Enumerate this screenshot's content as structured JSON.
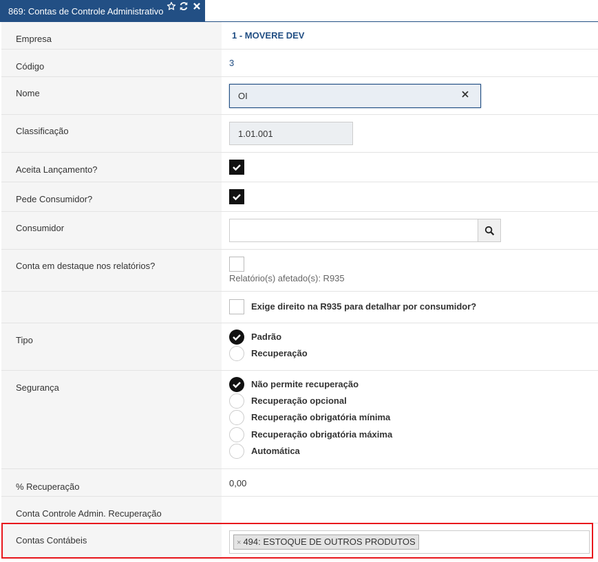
{
  "tab": {
    "title": "869: Contas de Controle Administrativo"
  },
  "colors": {
    "header": "#224f84",
    "highlight": "#e8161c"
  },
  "fields": {
    "empresa": {
      "label": "Empresa",
      "value": "1 - MOVERE DEV"
    },
    "codigo": {
      "label": "Código",
      "value": "3"
    },
    "nome": {
      "label": "Nome",
      "value": "OI"
    },
    "classificacao": {
      "label": "Classificação",
      "value": "1.01.001"
    },
    "aceita": {
      "label": "Aceita Lançamento?",
      "checked": true
    },
    "pede": {
      "label": "Pede Consumidor?",
      "checked": true
    },
    "consumidor": {
      "label": "Consumidor",
      "value": ""
    },
    "destaque": {
      "label": "Conta em destaque nos relatórios?",
      "checked": false,
      "hint": "Relatório(s) afetado(s): R935"
    },
    "exige": {
      "label": "Exige direito na R935 para detalhar por consumidor?",
      "checked": false
    },
    "tipo": {
      "label": "Tipo",
      "options": [
        "Padrão",
        "Recuperação"
      ],
      "selected": "Padrão"
    },
    "seguranca": {
      "label": "Segurança",
      "options": [
        "Não permite recuperação",
        "Recuperação opcional",
        "Recuperação obrigatória mínima",
        "Recuperação obrigatória máxima",
        "Automática"
      ],
      "selected": "Não permite recuperação"
    },
    "recuperacao": {
      "label": "% Recuperação",
      "value": "0,00"
    },
    "conta_controle": {
      "label": "Conta Controle Admin. Recuperação",
      "value": ""
    },
    "contas_contabeis": {
      "label": "Contas Contábeis",
      "tags": [
        "494: ESTOQUE DE OUTROS PRODUTOS"
      ]
    }
  }
}
